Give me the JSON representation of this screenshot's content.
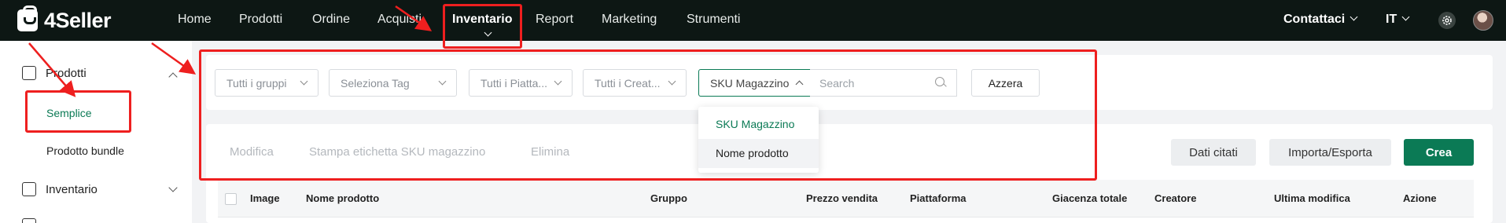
{
  "app": {
    "brand": "4Seller"
  },
  "nav": {
    "items": [
      "Home",
      "Prodotti",
      "Ordine",
      "Acquisti",
      "Inventario",
      "Report",
      "Marketing",
      "Strumenti"
    ],
    "active": "Inventario",
    "contact": "Contattaci",
    "language": "IT"
  },
  "sidebar": {
    "group_products": "Prodotti",
    "item_simple": "Semplice",
    "item_bundle": "Prodotto bundle",
    "group_inventory": "Inventario",
    "active_item": "Semplice"
  },
  "filters": {
    "groups": "Tutti i gruppi",
    "tag": "Seleziona Tag",
    "platform": "Tutti i Piatta...",
    "creator": "Tutti i Creat...",
    "search_field": "SKU Magazzino",
    "search_placeholder": "Search",
    "reset": "Azzera"
  },
  "dropdown": {
    "options": [
      "SKU Magazzino",
      "Nome prodotto"
    ],
    "selected": "SKU Magazzino"
  },
  "actions": {
    "edit": "Modifica",
    "print_label": "Stampa etichetta SKU magazzino",
    "delete": "Elimina",
    "cited_data": "Dati citati",
    "import_export": "Importa/Esporta",
    "create": "Crea"
  },
  "table": {
    "columns": [
      "Image",
      "Nome prodotto",
      "Gruppo",
      "Prezzo vendita",
      "Piattaforma",
      "Giacenza totale",
      "Creatore",
      "Ultima modifica",
      "Azione"
    ]
  },
  "colors": {
    "topbar": "#0d1714",
    "accent": "#0b7a55",
    "annotation": "#ee1f1f"
  }
}
